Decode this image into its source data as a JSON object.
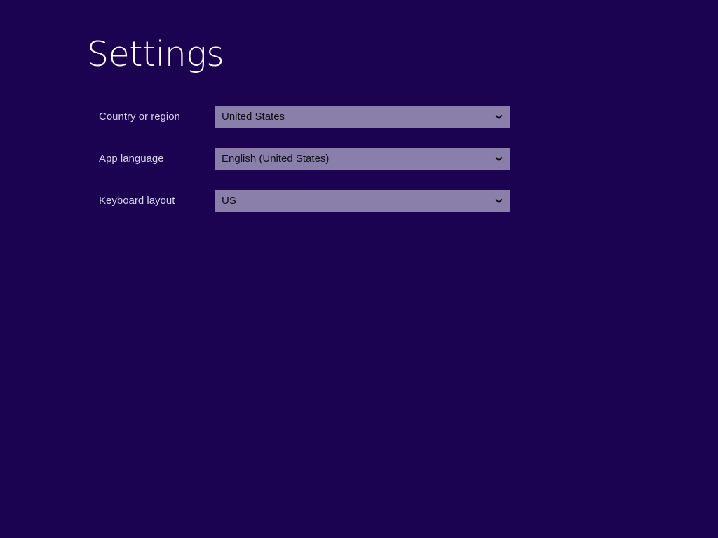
{
  "page": {
    "title": "Settings"
  },
  "settings": [
    {
      "label": "Country or region",
      "value": "United States"
    },
    {
      "label": "App language",
      "value": "English (United States)"
    },
    {
      "label": "Keyboard layout",
      "value": "US"
    }
  ],
  "icons": {
    "dropdown_indicator": "chevron-down-icon"
  },
  "colors": {
    "background": "#1c0352",
    "dropdown_fill": "#8a7fab",
    "label_text": "#d7d1ea",
    "title_text": "#ffffff"
  }
}
